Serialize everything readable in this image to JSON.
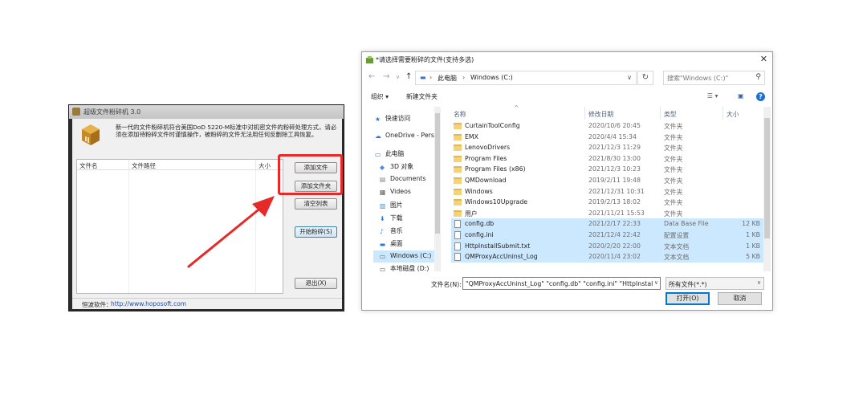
{
  "app": {
    "title": "超级文件粉碎机 3.0",
    "description": "新一代的文件粉碎机符合美国DoD 5220-M标准中对机密文件的粉碎处理方式，请必须在添加待粉碎文件时谨慎操作，被粉碎的文件无法用任何反删除工具恢复。",
    "columns": {
      "name": "文件名",
      "path": "文件路径",
      "size": "大小"
    },
    "buttons": {
      "add_file": "添加文件",
      "add_folder": "添加文件夹",
      "clear_list": "清空列表",
      "start": "开始粉碎(S)",
      "exit": "退出(X)"
    },
    "status_label": "恒波软件：",
    "status_url": "http://www.hoposoft.com",
    "colors": {
      "highlight": "#e62a2a",
      "arrow": "#e62a2a"
    }
  },
  "dialog": {
    "title": "*请选择需要粉碎的文件(支持多选)",
    "close": "✕",
    "breadcrumb": [
      "此电脑",
      "Windows (C:)"
    ],
    "search_placeholder": "搜索\"Windows (C:)\"",
    "toolbar": {
      "organize": "组织 ▾",
      "new_folder": "新建文件夹",
      "help": "?"
    },
    "nav": [
      {
        "label": "快速访问",
        "icon": "star-icon"
      },
      {
        "label": "OneDrive - Pers",
        "icon": "cloud-icon"
      },
      {
        "label": "此电脑",
        "icon": "computer-icon"
      },
      {
        "label": "3D 对象",
        "icon": "cube-icon"
      },
      {
        "label": "Documents",
        "icon": "document-icon"
      },
      {
        "label": "Videos",
        "icon": "video-icon"
      },
      {
        "label": "图片",
        "icon": "picture-icon"
      },
      {
        "label": "下载",
        "icon": "download-icon"
      },
      {
        "label": "音乐",
        "icon": "music-icon"
      },
      {
        "label": "桌面",
        "icon": "desktop-icon"
      },
      {
        "label": "Windows (C:)",
        "icon": "drive-icon"
      },
      {
        "label": "本地磁盘 (D:)",
        "icon": "drive-icon"
      }
    ],
    "columns": {
      "name": "名称",
      "date": "修改日期",
      "type": "类型",
      "size": "大小"
    },
    "rows": [
      {
        "name": "CurtainToolConfig",
        "date": "2020/10/6 20:45",
        "type": "文件夹",
        "size": "",
        "kind": "folder",
        "selected": false
      },
      {
        "name": "EMX",
        "date": "2020/4/4 15:34",
        "type": "文件夹",
        "size": "",
        "kind": "folder",
        "selected": false
      },
      {
        "name": "LenovoDrivers",
        "date": "2021/12/3 11:29",
        "type": "文件夹",
        "size": "",
        "kind": "folder",
        "selected": false
      },
      {
        "name": "Program Files",
        "date": "2021/8/30 13:00",
        "type": "文件夹",
        "size": "",
        "kind": "folder",
        "selected": false
      },
      {
        "name": "Program Files (x86)",
        "date": "2021/12/3 10:23",
        "type": "文件夹",
        "size": "",
        "kind": "folder",
        "selected": false
      },
      {
        "name": "QMDownload",
        "date": "2019/2/11 19:48",
        "type": "文件夹",
        "size": "",
        "kind": "folder",
        "selected": false
      },
      {
        "name": "Windows",
        "date": "2021/12/31 10:31",
        "type": "文件夹",
        "size": "",
        "kind": "folder",
        "selected": false
      },
      {
        "name": "Windows10Upgrade",
        "date": "2019/2/13 18:02",
        "type": "文件夹",
        "size": "",
        "kind": "folder",
        "selected": false
      },
      {
        "name": "用户",
        "date": "2021/11/21 15:53",
        "type": "文件夹",
        "size": "",
        "kind": "folder",
        "selected": false
      },
      {
        "name": "config.db",
        "date": "2021/2/17 22:33",
        "type": "Data Base File",
        "size": "12 KB",
        "kind": "file",
        "selected": true
      },
      {
        "name": "config.ini",
        "date": "2021/12/4 22:42",
        "type": "配置设置",
        "size": "1 KB",
        "kind": "file",
        "selected": true
      },
      {
        "name": "HttpInstallSubmit.txt",
        "date": "2020/2/20 22:00",
        "type": "文本文档",
        "size": "1 KB",
        "kind": "file",
        "selected": true
      },
      {
        "name": "QMProxyAccUninst_Log",
        "date": "2020/11/4 23:02",
        "type": "文本文档",
        "size": "5 KB",
        "kind": "file",
        "selected": true
      }
    ],
    "filename_label": "文件名(N):",
    "filename_value": "\"QMProxyAccUninst_Log\" \"config.db\" \"config.ini\" \"HttpInstallS",
    "filetype_value": "所有文件(*.*)",
    "open_button": "打开(O)",
    "cancel_button": "取消",
    "colors": {
      "selection": "#cce8ff",
      "primary": "#0078d7"
    }
  }
}
